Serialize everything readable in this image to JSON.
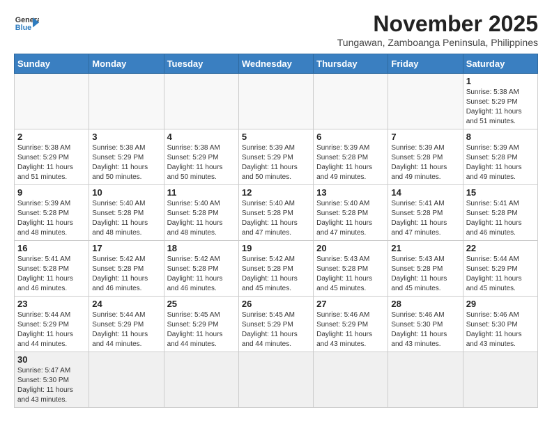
{
  "header": {
    "logo_general": "General",
    "logo_blue": "Blue",
    "month_title": "November 2025",
    "subtitle": "Tungawan, Zamboanga Peninsula, Philippines"
  },
  "weekdays": [
    "Sunday",
    "Monday",
    "Tuesday",
    "Wednesday",
    "Thursday",
    "Friday",
    "Saturday"
  ],
  "days": {
    "d1": {
      "num": "1",
      "sunrise": "Sunrise: 5:38 AM",
      "sunset": "Sunset: 5:29 PM",
      "daylight": "Daylight: 11 hours and 51 minutes."
    },
    "d2": {
      "num": "2",
      "sunrise": "Sunrise: 5:38 AM",
      "sunset": "Sunset: 5:29 PM",
      "daylight": "Daylight: 11 hours and 51 minutes."
    },
    "d3": {
      "num": "3",
      "sunrise": "Sunrise: 5:38 AM",
      "sunset": "Sunset: 5:29 PM",
      "daylight": "Daylight: 11 hours and 50 minutes."
    },
    "d4": {
      "num": "4",
      "sunrise": "Sunrise: 5:38 AM",
      "sunset": "Sunset: 5:29 PM",
      "daylight": "Daylight: 11 hours and 50 minutes."
    },
    "d5": {
      "num": "5",
      "sunrise": "Sunrise: 5:39 AM",
      "sunset": "Sunset: 5:29 PM",
      "daylight": "Daylight: 11 hours and 50 minutes."
    },
    "d6": {
      "num": "6",
      "sunrise": "Sunrise: 5:39 AM",
      "sunset": "Sunset: 5:28 PM",
      "daylight": "Daylight: 11 hours and 49 minutes."
    },
    "d7": {
      "num": "7",
      "sunrise": "Sunrise: 5:39 AM",
      "sunset": "Sunset: 5:28 PM",
      "daylight": "Daylight: 11 hours and 49 minutes."
    },
    "d8": {
      "num": "8",
      "sunrise": "Sunrise: 5:39 AM",
      "sunset": "Sunset: 5:28 PM",
      "daylight": "Daylight: 11 hours and 49 minutes."
    },
    "d9": {
      "num": "9",
      "sunrise": "Sunrise: 5:39 AM",
      "sunset": "Sunset: 5:28 PM",
      "daylight": "Daylight: 11 hours and 48 minutes."
    },
    "d10": {
      "num": "10",
      "sunrise": "Sunrise: 5:40 AM",
      "sunset": "Sunset: 5:28 PM",
      "daylight": "Daylight: 11 hours and 48 minutes."
    },
    "d11": {
      "num": "11",
      "sunrise": "Sunrise: 5:40 AM",
      "sunset": "Sunset: 5:28 PM",
      "daylight": "Daylight: 11 hours and 48 minutes."
    },
    "d12": {
      "num": "12",
      "sunrise": "Sunrise: 5:40 AM",
      "sunset": "Sunset: 5:28 PM",
      "daylight": "Daylight: 11 hours and 47 minutes."
    },
    "d13": {
      "num": "13",
      "sunrise": "Sunrise: 5:40 AM",
      "sunset": "Sunset: 5:28 PM",
      "daylight": "Daylight: 11 hours and 47 minutes."
    },
    "d14": {
      "num": "14",
      "sunrise": "Sunrise: 5:41 AM",
      "sunset": "Sunset: 5:28 PM",
      "daylight": "Daylight: 11 hours and 47 minutes."
    },
    "d15": {
      "num": "15",
      "sunrise": "Sunrise: 5:41 AM",
      "sunset": "Sunset: 5:28 PM",
      "daylight": "Daylight: 11 hours and 46 minutes."
    },
    "d16": {
      "num": "16",
      "sunrise": "Sunrise: 5:41 AM",
      "sunset": "Sunset: 5:28 PM",
      "daylight": "Daylight: 11 hours and 46 minutes."
    },
    "d17": {
      "num": "17",
      "sunrise": "Sunrise: 5:42 AM",
      "sunset": "Sunset: 5:28 PM",
      "daylight": "Daylight: 11 hours and 46 minutes."
    },
    "d18": {
      "num": "18",
      "sunrise": "Sunrise: 5:42 AM",
      "sunset": "Sunset: 5:28 PM",
      "daylight": "Daylight: 11 hours and 46 minutes."
    },
    "d19": {
      "num": "19",
      "sunrise": "Sunrise: 5:42 AM",
      "sunset": "Sunset: 5:28 PM",
      "daylight": "Daylight: 11 hours and 45 minutes."
    },
    "d20": {
      "num": "20",
      "sunrise": "Sunrise: 5:43 AM",
      "sunset": "Sunset: 5:28 PM",
      "daylight": "Daylight: 11 hours and 45 minutes."
    },
    "d21": {
      "num": "21",
      "sunrise": "Sunrise: 5:43 AM",
      "sunset": "Sunset: 5:28 PM",
      "daylight": "Daylight: 11 hours and 45 minutes."
    },
    "d22": {
      "num": "22",
      "sunrise": "Sunrise: 5:44 AM",
      "sunset": "Sunset: 5:29 PM",
      "daylight": "Daylight: 11 hours and 45 minutes."
    },
    "d23": {
      "num": "23",
      "sunrise": "Sunrise: 5:44 AM",
      "sunset": "Sunset: 5:29 PM",
      "daylight": "Daylight: 11 hours and 44 minutes."
    },
    "d24": {
      "num": "24",
      "sunrise": "Sunrise: 5:44 AM",
      "sunset": "Sunset: 5:29 PM",
      "daylight": "Daylight: 11 hours and 44 minutes."
    },
    "d25": {
      "num": "25",
      "sunrise": "Sunrise: 5:45 AM",
      "sunset": "Sunset: 5:29 PM",
      "daylight": "Daylight: 11 hours and 44 minutes."
    },
    "d26": {
      "num": "26",
      "sunrise": "Sunrise: 5:45 AM",
      "sunset": "Sunset: 5:29 PM",
      "daylight": "Daylight: 11 hours and 44 minutes."
    },
    "d27": {
      "num": "27",
      "sunrise": "Sunrise: 5:46 AM",
      "sunset": "Sunset: 5:29 PM",
      "daylight": "Daylight: 11 hours and 43 minutes."
    },
    "d28": {
      "num": "28",
      "sunrise": "Sunrise: 5:46 AM",
      "sunset": "Sunset: 5:30 PM",
      "daylight": "Daylight: 11 hours and 43 minutes."
    },
    "d29": {
      "num": "29",
      "sunrise": "Sunrise: 5:46 AM",
      "sunset": "Sunset: 5:30 PM",
      "daylight": "Daylight: 11 hours and 43 minutes."
    },
    "d30": {
      "num": "30",
      "sunrise": "Sunrise: 5:47 AM",
      "sunset": "Sunset: 5:30 PM",
      "daylight": "Daylight: 11 hours and 43 minutes."
    }
  }
}
